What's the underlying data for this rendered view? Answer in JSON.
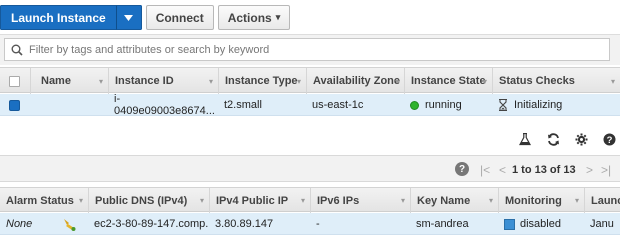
{
  "toolbar": {
    "launch_label": "Launch Instance",
    "connect_label": "Connect",
    "actions_label": "Actions"
  },
  "search": {
    "placeholder": "Filter by tags and attributes or search by keyword"
  },
  "instances_table": {
    "headers": [
      "Name",
      "Instance ID",
      "Instance Type",
      "Availability Zone",
      "Instance State",
      "Status Checks"
    ],
    "row": {
      "name": "",
      "instance_id": "i-0409e09003e8674...",
      "instance_type": "t2.small",
      "availability_zone": "us-east-1c",
      "instance_state": "running",
      "status_checks": "Initializing"
    }
  },
  "pagination": {
    "range": "1 to 13 of 13"
  },
  "details_table": {
    "headers": [
      "Alarm Status",
      "Public DNS (IPv4)",
      "IPv4 Public IP",
      "IPv6 IPs",
      "Key Name",
      "Monitoring",
      "Launc"
    ],
    "row": {
      "alarm_status": "None",
      "public_dns": "ec2-3-80-89-147.comp...",
      "ipv4_public_ip": "3.80.89.147",
      "ipv6_ips": "-",
      "key_name": "sm-andrea",
      "monitoring": "disabled",
      "launch_time": "Janu"
    }
  },
  "colors": {
    "primary": "#1a6fc2",
    "running": "#2fb32f",
    "selected_row": "#dfeef9"
  }
}
